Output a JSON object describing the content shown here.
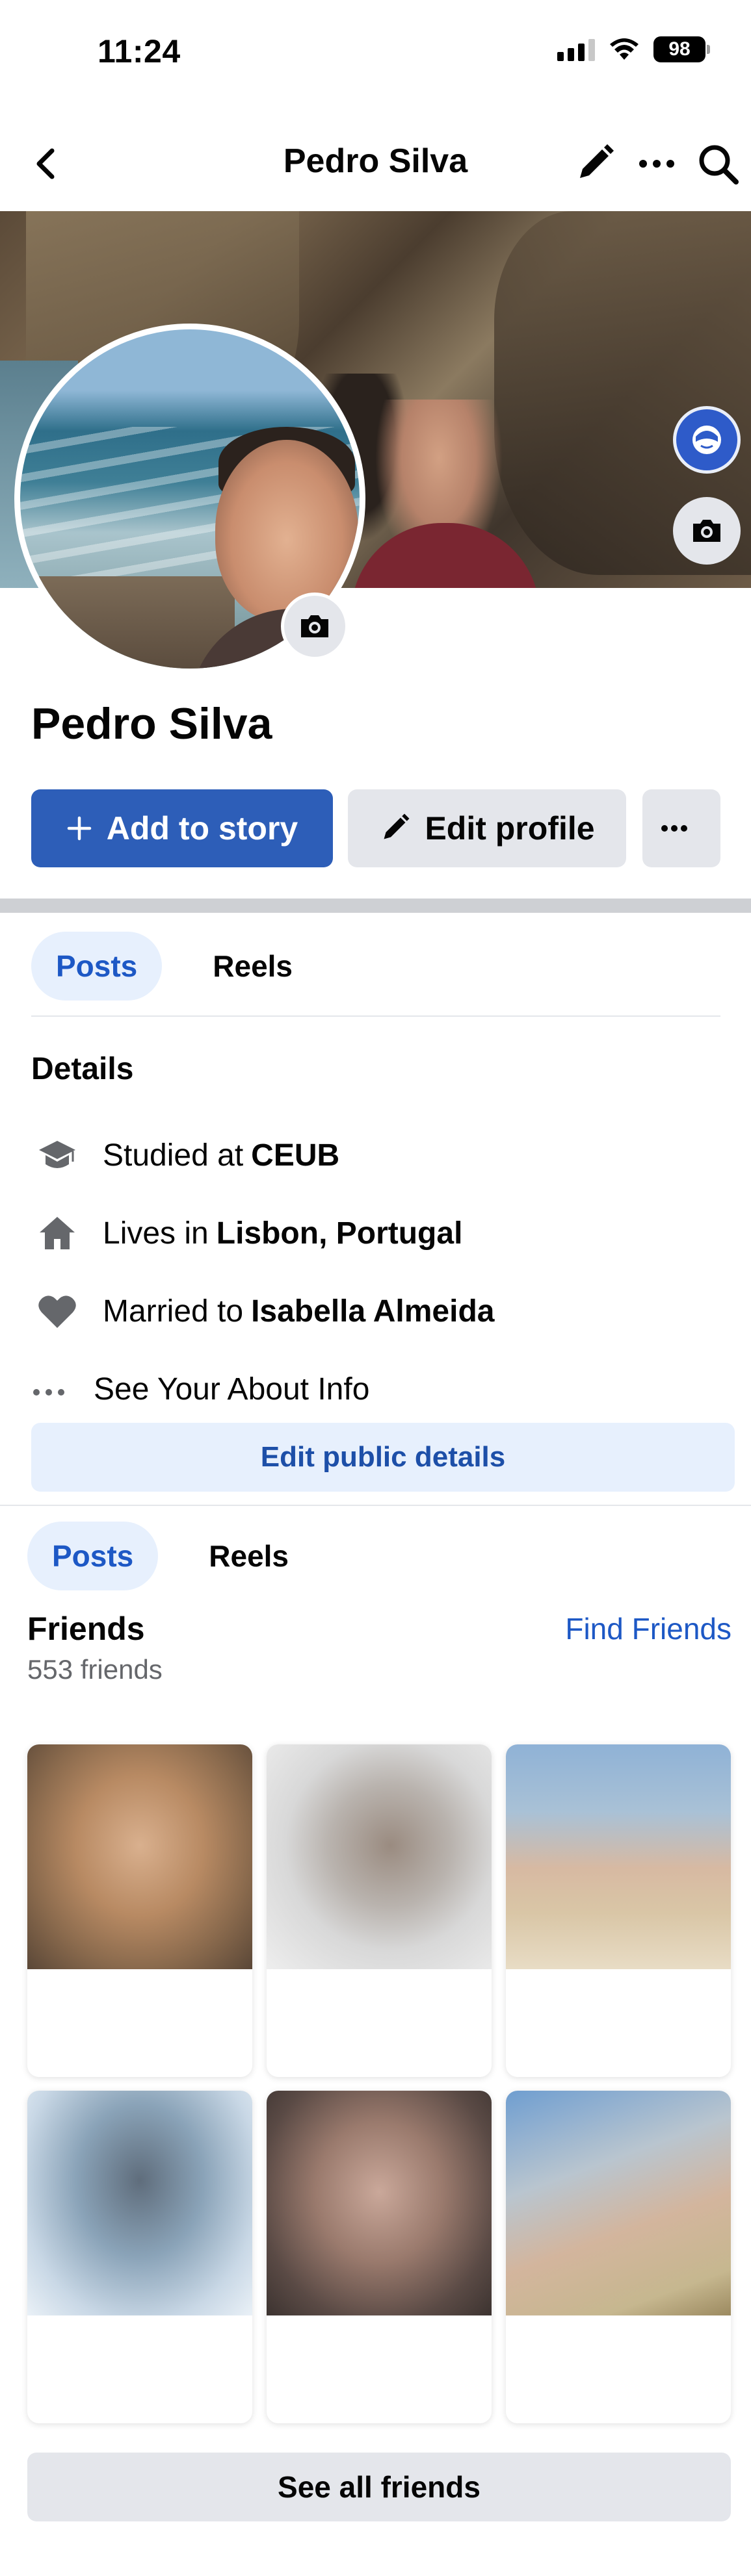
{
  "status_bar": {
    "time": "11:24",
    "battery": "98"
  },
  "nav": {
    "title": "Pedro Silva"
  },
  "profile": {
    "name": "Pedro Silva"
  },
  "actions": {
    "add_to_story": "Add to story",
    "edit_profile": "Edit profile"
  },
  "tabs_top": [
    {
      "label": "Posts",
      "active": true
    },
    {
      "label": "Reels",
      "active": false
    }
  ],
  "details": {
    "heading": "Details",
    "items": [
      {
        "icon": "graduation-cap-icon",
        "prefix": "Studied at",
        "value": "CEUB"
      },
      {
        "icon": "home-icon",
        "prefix": "Lives in",
        "value": "Lisbon, Portugal"
      },
      {
        "icon": "heart-icon",
        "prefix": "Married to",
        "value": "Isabella Almeida"
      }
    ],
    "see_about": "See Your About Info",
    "edit_public_details": "Edit public details"
  },
  "tabs_bottom": [
    {
      "label": "Posts",
      "active": true
    },
    {
      "label": "Reels",
      "active": false
    }
  ],
  "friends": {
    "heading": "Friends",
    "count": "553 friends",
    "find_friends": "Find Friends",
    "see_all": "See all friends"
  },
  "colors": {
    "primary": "#2d5eb8",
    "link": "#1d58c5",
    "tab_active_bg": "#e7f0fd",
    "button_gray": "#e4e6eb"
  }
}
